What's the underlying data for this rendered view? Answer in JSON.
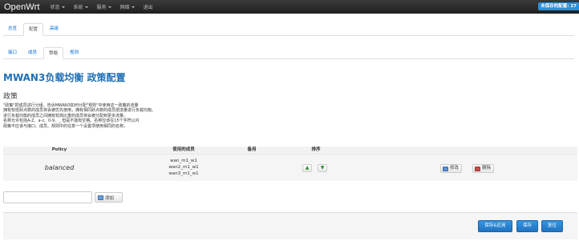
{
  "navbar": {
    "brand": "OpenWrt",
    "menu": [
      "状态",
      "系统",
      "服务",
      "网络",
      "退出"
    ],
    "unsaved": "未保存的配置: 27"
  },
  "tabs_main": [
    "总览",
    "配置",
    "高级"
  ],
  "tabs_sub": [
    "接口",
    "成员",
    "策略",
    "规则"
  ],
  "page_title": "MWAN3负载均衡 政策配置",
  "section_title": "政策",
  "description": [
    "\"政策\"把成员进行分组，告诉MWAN3如何分配\"规则\"中使用这一政策的流量",
    "拥有较低跃点数的成员将会被优先使用，拥有相同跃点数的成员把流量进行负载均衡。",
    "进行负载均衡的成员之间拥有较高比重的成员将会被分配到更多流量。",
    "名称允许包括A-Z、a-z、0-9、_ 但是不能有空格。名称应该在15个字符以内",
    "政策不应该与接口、成员、规则中的任意一个设置项使用相同的名称。"
  ],
  "table": {
    "headers": [
      "Policy",
      "使用的成员",
      "备用",
      "排序"
    ],
    "rows": [
      {
        "policy": "balanced",
        "members": [
          "wan_m1_w1",
          "wan2_m1_w1",
          "wan3_m1_w1"
        ],
        "backup": "",
        "up_symbol": "▲",
        "down_symbol": "▼",
        "edit_label": "修改",
        "delete_label": "删除"
      }
    ]
  },
  "add": {
    "input_value": "",
    "button_label": "添加"
  },
  "footer": {
    "save_apply": "保存&应用",
    "save": "保存",
    "reset": "复位"
  }
}
